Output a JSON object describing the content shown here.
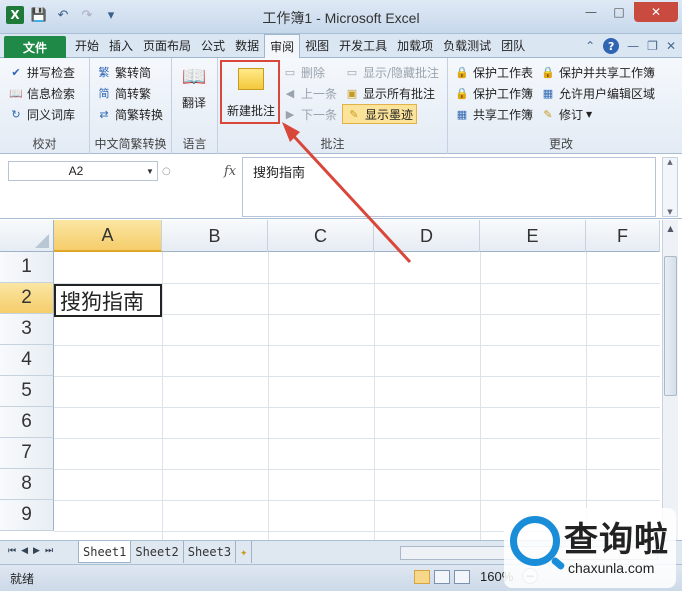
{
  "window": {
    "title": "工作簿1 - Microsoft Excel",
    "app_icon": "excel-logo",
    "app_icon_letter": "X",
    "controls": [
      "minimize",
      "maximize",
      "close"
    ]
  },
  "quick_access": [
    "save-icon",
    "undo-icon",
    "redo-icon",
    "customize-icon"
  ],
  "tabs": {
    "file": "文件",
    "items": [
      "开始",
      "插入",
      "页面布局",
      "公式",
      "数据",
      "审阅",
      "视图",
      "开发工具",
      "加载项",
      "负载测试",
      "团队"
    ],
    "active": "审阅"
  },
  "ribbon": {
    "proofing": {
      "label": "校对",
      "items": [
        "拼写检查",
        "信息检索",
        "同义词库"
      ]
    },
    "chinese": {
      "label": "中文简繁转换",
      "items": [
        "繁转简",
        "简转繁",
        "简繁转换"
      ]
    },
    "language": {
      "label": "语言",
      "translate": "翻译"
    },
    "comments": {
      "label": "批注",
      "new_comment": "新建批注",
      "delete": "删除",
      "prev": "上一条",
      "next": "下一条",
      "show_hide": "显示/隐藏批注",
      "show_all": "显示所有批注",
      "show_ink": "显示墨迹"
    },
    "changes": {
      "label": "更改",
      "protect_sheet": "保护工作表",
      "protect_workbook": "保护工作簿",
      "share_workbook": "共享工作簿",
      "protect_share": "保护并共享工作簿",
      "allow_edit": "允许用户编辑区域",
      "track": "修订"
    }
  },
  "formula_bar": {
    "name_box": "A2",
    "fx": "fx",
    "content": "搜狗指南"
  },
  "grid": {
    "columns": [
      "A",
      "B",
      "C",
      "D",
      "E",
      "F"
    ],
    "rows": [
      "1",
      "2",
      "3",
      "4",
      "5",
      "6",
      "7",
      "8",
      "9"
    ],
    "selected_col": "A",
    "selected_row": "2",
    "cell_a2": "搜狗指南"
  },
  "sheets": {
    "tabs": [
      "Sheet1",
      "Sheet2",
      "Sheet3"
    ],
    "active": "Sheet1"
  },
  "status": {
    "mode": "就绪",
    "zoom": "160%"
  },
  "watermark": {
    "brand": "查询啦",
    "url": "chaxunla.com"
  },
  "colors": {
    "file_tab": "#1f8a47",
    "highlight": "#d9473b",
    "selection": "#f5cd6b"
  }
}
